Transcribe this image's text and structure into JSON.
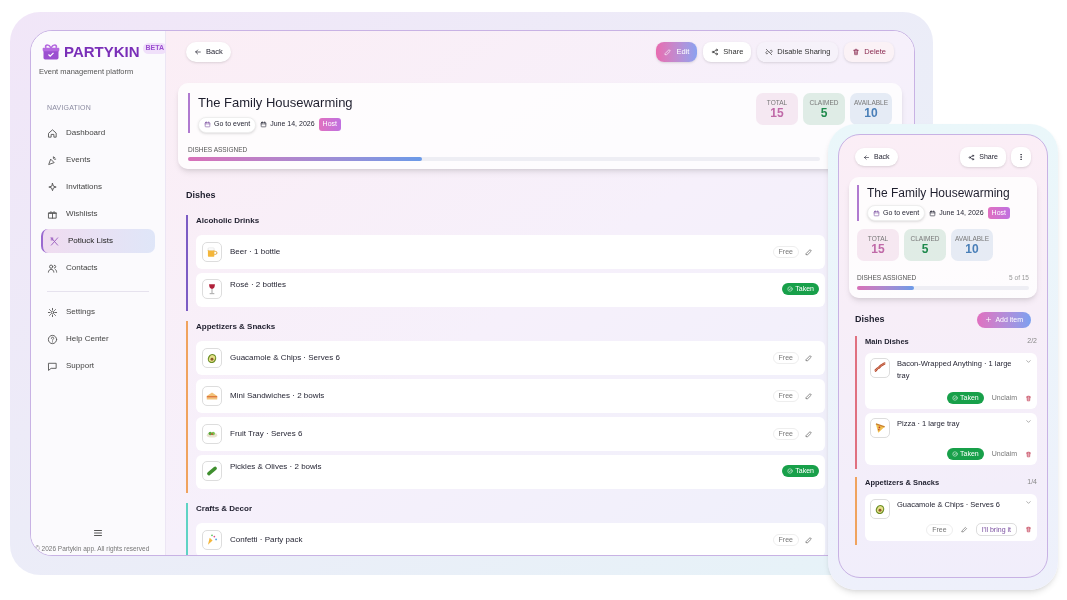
{
  "tablet": {
    "brand": {
      "name": "PARTYKIN",
      "badge": "BETA",
      "tagline": "Event management platform"
    },
    "sidebar": {
      "heading": "NAVIGATION",
      "items": [
        {
          "label": "Dashboard",
          "kind": "home",
          "selected": false
        },
        {
          "label": "Events",
          "kind": "popper",
          "selected": false
        },
        {
          "label": "Invitations",
          "kind": "sparkle",
          "selected": false
        },
        {
          "label": "Wishlists",
          "kind": "gift",
          "selected": false
        },
        {
          "label": "Potluck Lists",
          "kind": "utensils",
          "selected": true
        },
        {
          "label": "Contacts",
          "kind": "users",
          "selected": false
        }
      ],
      "bottom_items": [
        {
          "label": "Settings",
          "kind": "gear",
          "selected": false
        },
        {
          "label": "Help Center",
          "kind": "help",
          "selected": false
        },
        {
          "label": "Support",
          "kind": "chat",
          "selected": false
        }
      ],
      "footer": "© 2026 Partykin app. All rights reserved"
    },
    "back": "Back",
    "actions": [
      {
        "label": "Edit",
        "kind": "edit"
      },
      {
        "label": "Share",
        "kind": "share"
      },
      {
        "label": "Disable Sharing",
        "kind": "unlink"
      },
      {
        "label": "Delete",
        "kind": "delete"
      }
    ],
    "event": {
      "title": "The Family Housewarming",
      "link": "Go to event",
      "date": "June 14, 2026",
      "role": "Host",
      "stats": [
        {
          "label": "TOTAL",
          "value": "15",
          "color": "#c06aa8"
        },
        {
          "label": "CLAIMED",
          "value": "5",
          "color": "#1f8a4c"
        },
        {
          "label": "AVAILABLE",
          "value": "10",
          "color": "#4a7fb8"
        }
      ],
      "progress_label": "DISHES ASSIGNED",
      "level": 0.37
    },
    "dishes_heading": "Dishes",
    "sections": [
      {
        "name": "Alcoholic Drinks",
        "color": "#7c5cc4",
        "items": [
          {
            "name": "Beer · 1 bottle",
            "kind": "beer",
            "taken": false,
            "status": "Free"
          },
          {
            "name": "Rosé · 2 bottles",
            "kind": "wine",
            "taken": true,
            "status": "Taken"
          }
        ]
      },
      {
        "name": "Appetizers & Snacks",
        "color": "#f0a35e",
        "items": [
          {
            "name": "Guacamole & Chips · Serves 6",
            "kind": "avocado",
            "taken": false,
            "status": "Free"
          },
          {
            "name": "Mini Sandwiches · 2 bowls",
            "kind": "sandwich",
            "taken": false,
            "status": "Free"
          },
          {
            "name": "Fruit Tray · Serves 6",
            "kind": "salad",
            "taken": false,
            "status": "Free"
          },
          {
            "name": "Pickles & Olives · 2 bowls",
            "kind": "cucumber",
            "taken": true,
            "status": "Taken"
          }
        ]
      },
      {
        "name": "Crafts & Decor",
        "color": "#5fd3c4",
        "items": [
          {
            "name": "Confetti · Party pack",
            "kind": "confetti",
            "taken": false,
            "status": "Free"
          }
        ]
      }
    ]
  },
  "phone": {
    "back": "Back",
    "share": "Share",
    "event": {
      "title": "The Family Housewarming",
      "link": "Go to event",
      "date": "June 14, 2026",
      "role": "Host",
      "stats": [
        {
          "label": "TOTAL",
          "value": "15",
          "color": "#c06aa8"
        },
        {
          "label": "CLAIMED",
          "value": "5",
          "color": "#1f8a4c"
        },
        {
          "label": "AVAILABLE",
          "value": "10",
          "color": "#4a7fb8"
        }
      ],
      "progress_label": "DISHES ASSIGNED",
      "progress_count": "5 of 15",
      "level": 0.333
    },
    "dishes_heading": "Dishes",
    "add_item": "Add item",
    "sections": [
      {
        "name": "Main Dishes",
        "count": "2/2",
        "color": "#e07080",
        "items": [
          {
            "name": "Bacon-Wrapped Anything · 1 large tray",
            "kind": "bacon",
            "taken": true,
            "status": "Taken",
            "action": "Unclaim"
          },
          {
            "name": "Pizza · 1 large tray",
            "kind": "pizza",
            "taken": true,
            "status": "Taken",
            "action": "Unclaim"
          }
        ]
      },
      {
        "name": "Appetizers & Snacks",
        "count": "1/4",
        "color": "#f0a35e",
        "items": [
          {
            "name": "Guacamole & Chips · Serves 6",
            "kind": "avocado",
            "taken": false,
            "status": "Free",
            "action": "I'll bring it"
          }
        ]
      }
    ]
  }
}
